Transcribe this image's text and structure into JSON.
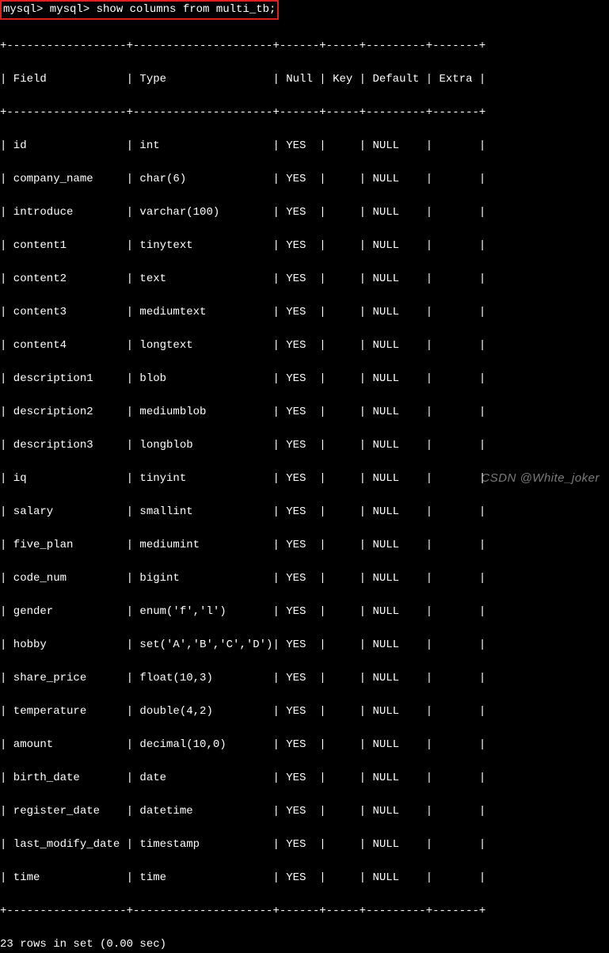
{
  "prompt": "mysql> mysql> show columns from multi_tb;",
  "separator": "+------------------+---------------------+------+-----+---------+-------+",
  "header": "| Field            | Type                | Null | Key | Default | Extra |",
  "rows": [
    "| id               | int                 | YES  |     | NULL    |       |",
    "| company_name     | char(6)             | YES  |     | NULL    |       |",
    "| introduce        | varchar(100)        | YES  |     | NULL    |       |",
    "| content1         | tinytext            | YES  |     | NULL    |       |",
    "| content2         | text                | YES  |     | NULL    |       |",
    "| content3         | mediumtext          | YES  |     | NULL    |       |",
    "| content4         | longtext            | YES  |     | NULL    |       |",
    "| description1     | blob                | YES  |     | NULL    |       |",
    "| description2     | mediumblob          | YES  |     | NULL    |       |",
    "| description3     | longblob            | YES  |     | NULL    |       |",
    "| iq               | tinyint             | YES  |     | NULL    |       |",
    "| salary           | smallint            | YES  |     | NULL    |       |",
    "| five_plan        | mediumint           | YES  |     | NULL    |       |",
    "| code_num         | bigint              | YES  |     | NULL    |       |",
    "| gender           | enum('f','l')       | YES  |     | NULL    |       |",
    "| hobby            | set('A','B','C','D')| YES  |     | NULL    |       |",
    "| share_price      | float(10,3)         | YES  |     | NULL    |       |",
    "| temperature      | double(4,2)         | YES  |     | NULL    |       |",
    "| amount           | decimal(10,0)       | YES  |     | NULL    |       |",
    "| birth_date       | date                | YES  |     | NULL    |       |",
    "| register_date    | datetime            | YES  |     | NULL    |       |",
    "| last_modify_date | timestamp           | YES  |     | NULL    |       |",
    "| time             | time                | YES  |     | NULL    |       |"
  ],
  "footer": "23 rows in set (0.00 sec)",
  "watermark": "CSDN @White_joker",
  "chart_data": {
    "type": "table",
    "columns": [
      "Field",
      "Type",
      "Null",
      "Key",
      "Default",
      "Extra"
    ],
    "data": [
      {
        "Field": "id",
        "Type": "int",
        "Null": "YES",
        "Key": "",
        "Default": "NULL",
        "Extra": ""
      },
      {
        "Field": "company_name",
        "Type": "char(6)",
        "Null": "YES",
        "Key": "",
        "Default": "NULL",
        "Extra": ""
      },
      {
        "Field": "introduce",
        "Type": "varchar(100)",
        "Null": "YES",
        "Key": "",
        "Default": "NULL",
        "Extra": ""
      },
      {
        "Field": "content1",
        "Type": "tinytext",
        "Null": "YES",
        "Key": "",
        "Default": "NULL",
        "Extra": ""
      },
      {
        "Field": "content2",
        "Type": "text",
        "Null": "YES",
        "Key": "",
        "Default": "NULL",
        "Extra": ""
      },
      {
        "Field": "content3",
        "Type": "mediumtext",
        "Null": "YES",
        "Key": "",
        "Default": "NULL",
        "Extra": ""
      },
      {
        "Field": "content4",
        "Type": "longtext",
        "Null": "YES",
        "Key": "",
        "Default": "NULL",
        "Extra": ""
      },
      {
        "Field": "description1",
        "Type": "blob",
        "Null": "YES",
        "Key": "",
        "Default": "NULL",
        "Extra": ""
      },
      {
        "Field": "description2",
        "Type": "mediumblob",
        "Null": "YES",
        "Key": "",
        "Default": "NULL",
        "Extra": ""
      },
      {
        "Field": "description3",
        "Type": "longblob",
        "Null": "YES",
        "Key": "",
        "Default": "NULL",
        "Extra": ""
      },
      {
        "Field": "iq",
        "Type": "tinyint",
        "Null": "YES",
        "Key": "",
        "Default": "NULL",
        "Extra": ""
      },
      {
        "Field": "salary",
        "Type": "smallint",
        "Null": "YES",
        "Key": "",
        "Default": "NULL",
        "Extra": ""
      },
      {
        "Field": "five_plan",
        "Type": "mediumint",
        "Null": "YES",
        "Key": "",
        "Default": "NULL",
        "Extra": ""
      },
      {
        "Field": "code_num",
        "Type": "bigint",
        "Null": "YES",
        "Key": "",
        "Default": "NULL",
        "Extra": ""
      },
      {
        "Field": "gender",
        "Type": "enum('f','l')",
        "Null": "YES",
        "Key": "",
        "Default": "NULL",
        "Extra": ""
      },
      {
        "Field": "hobby",
        "Type": "set('A','B','C','D')",
        "Null": "YES",
        "Key": "",
        "Default": "NULL",
        "Extra": ""
      },
      {
        "Field": "share_price",
        "Type": "float(10,3)",
        "Null": "YES",
        "Key": "",
        "Default": "NULL",
        "Extra": ""
      },
      {
        "Field": "temperature",
        "Type": "double(4,2)",
        "Null": "YES",
        "Key": "",
        "Default": "NULL",
        "Extra": ""
      },
      {
        "Field": "amount",
        "Type": "decimal(10,0)",
        "Null": "YES",
        "Key": "",
        "Default": "NULL",
        "Extra": ""
      },
      {
        "Field": "birth_date",
        "Type": "date",
        "Null": "YES",
        "Key": "",
        "Default": "NULL",
        "Extra": ""
      },
      {
        "Field": "register_date",
        "Type": "datetime",
        "Null": "YES",
        "Key": "",
        "Default": "NULL",
        "Extra": ""
      },
      {
        "Field": "last_modify_date",
        "Type": "timestamp",
        "Null": "YES",
        "Key": "",
        "Default": "NULL",
        "Extra": ""
      },
      {
        "Field": "time",
        "Type": "time",
        "Null": "YES",
        "Key": "",
        "Default": "NULL",
        "Extra": ""
      }
    ]
  }
}
